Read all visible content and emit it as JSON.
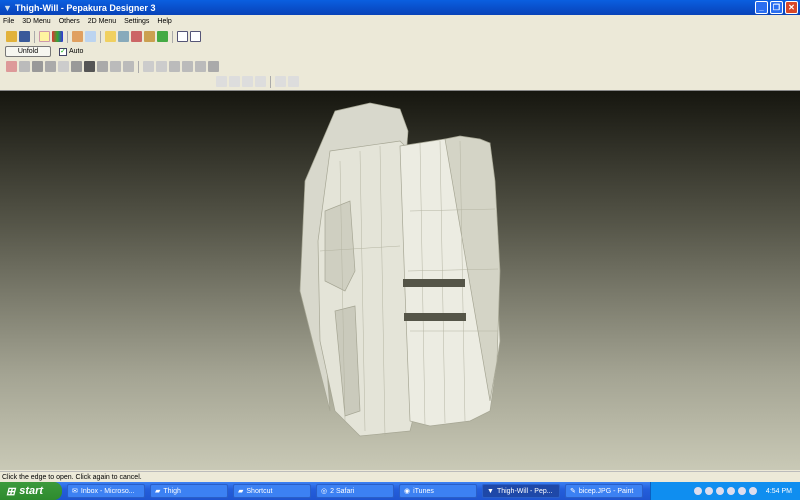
{
  "window": {
    "title": "Thigh-Will - Pepakura Designer 3"
  },
  "menu": [
    "File",
    "3D Menu",
    "Others",
    "2D Menu",
    "Settings",
    "Help"
  ],
  "toolbar": {
    "unfold_label": "Unfold",
    "auto_label": "Auto",
    "auto_checked": true
  },
  "status": "Click the edge to open. Click again to cancel.",
  "taskbar": {
    "start_label": "start",
    "tasks": [
      "Inbox - Microso...",
      "Thigh",
      "Shortcut",
      "2 Safari",
      "iTunes",
      "Thigh-Will - Pep...",
      "bicep.JPG - Paint"
    ],
    "active_task": 5,
    "clock": "4:54 PM"
  }
}
